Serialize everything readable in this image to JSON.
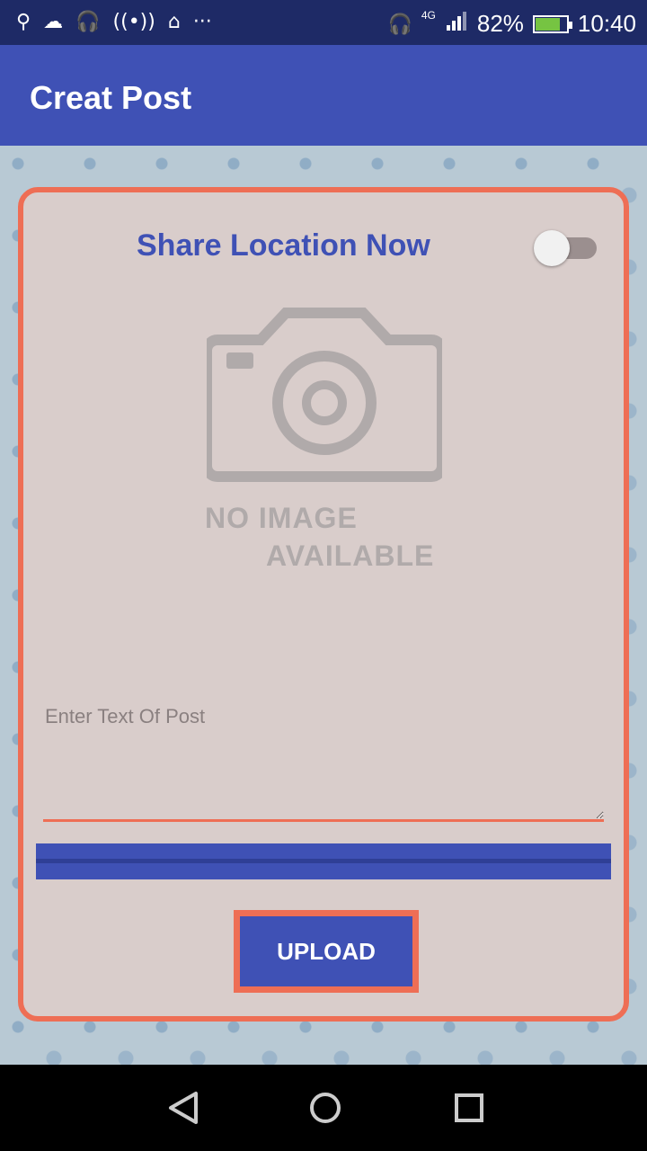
{
  "status_bar": {
    "left_icons": [
      "usb-icon",
      "cloud-icon",
      "headset-icon",
      "hotspot-icon",
      "android-icon",
      "more-icon"
    ],
    "network_label": "4G",
    "battery_percent": "82%",
    "battery_level": 0.82,
    "time": "10:40",
    "battery_color": "#76c442"
  },
  "app_bar": {
    "title": "Creat Post",
    "color": "#3f51b5"
  },
  "card": {
    "share_location_label": "Share Location Now",
    "share_location_enabled": false,
    "no_image_line1": "NO IMAGE",
    "no_image_line2": "AVAILABLE",
    "post_input_placeholder": "Enter Text Of Post",
    "post_input_value": "",
    "upload_label": "UPLOAD",
    "accent_color": "#ee6e55"
  },
  "nav_bar": {
    "icons": [
      "back-icon",
      "home-icon",
      "recent-apps-icon"
    ]
  }
}
